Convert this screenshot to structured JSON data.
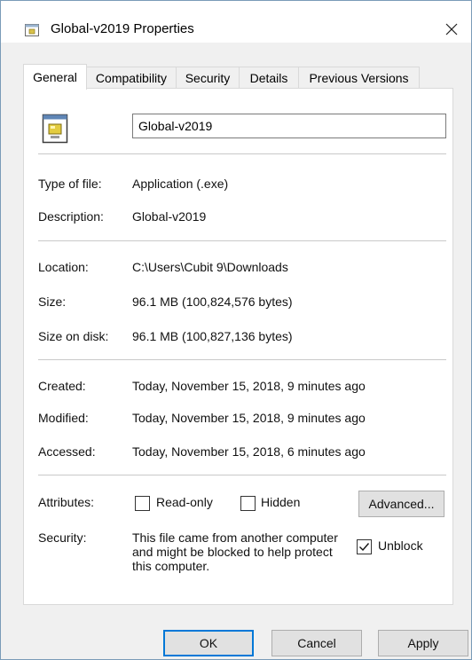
{
  "window": {
    "title": "Global-v2019 Properties"
  },
  "tabs": [
    {
      "label": "General",
      "active": true
    },
    {
      "label": "Compatibility",
      "active": false
    },
    {
      "label": "Security",
      "active": false
    },
    {
      "label": "Details",
      "active": false
    },
    {
      "label": "Previous Versions",
      "active": false
    }
  ],
  "file": {
    "name": "Global-v2019"
  },
  "info": {
    "type_label": "Type of file:",
    "type_value": "Application (.exe)",
    "desc_label": "Description:",
    "desc_value": "Global-v2019",
    "location_label": "Location:",
    "location_value": "C:\\Users\\Cubit 9\\Downloads",
    "size_label": "Size:",
    "size_value": "96.1 MB (100,824,576 bytes)",
    "sizeondisk_label": "Size on disk:",
    "sizeondisk_value": "96.1 MB (100,827,136 bytes)",
    "created_label": "Created:",
    "created_value": "Today, November 15, 2018, 9 minutes ago",
    "modified_label": "Modified:",
    "modified_value": "Today, November 15, 2018, 9 minutes ago",
    "accessed_label": "Accessed:",
    "accessed_value": "Today, November 15, 2018, 6 minutes ago"
  },
  "attributes": {
    "label": "Attributes:",
    "readonly_label": "Read-only",
    "readonly_checked": false,
    "hidden_label": "Hidden",
    "hidden_checked": false,
    "advanced_label": "Advanced..."
  },
  "security": {
    "label": "Security:",
    "text": "This file came from another computer and might be blocked to help protect this computer.",
    "unblock_label": "Unblock",
    "unblock_checked": true
  },
  "buttons": {
    "ok": "OK",
    "cancel": "Cancel",
    "apply": "Apply"
  },
  "icons": {
    "title": "exe-file-icon",
    "close": "close-icon",
    "file": "exe-file-icon"
  },
  "colors": {
    "accent": "#0078d7",
    "panel_bg": "#ffffff",
    "window_bg": "#f0f0f0"
  }
}
